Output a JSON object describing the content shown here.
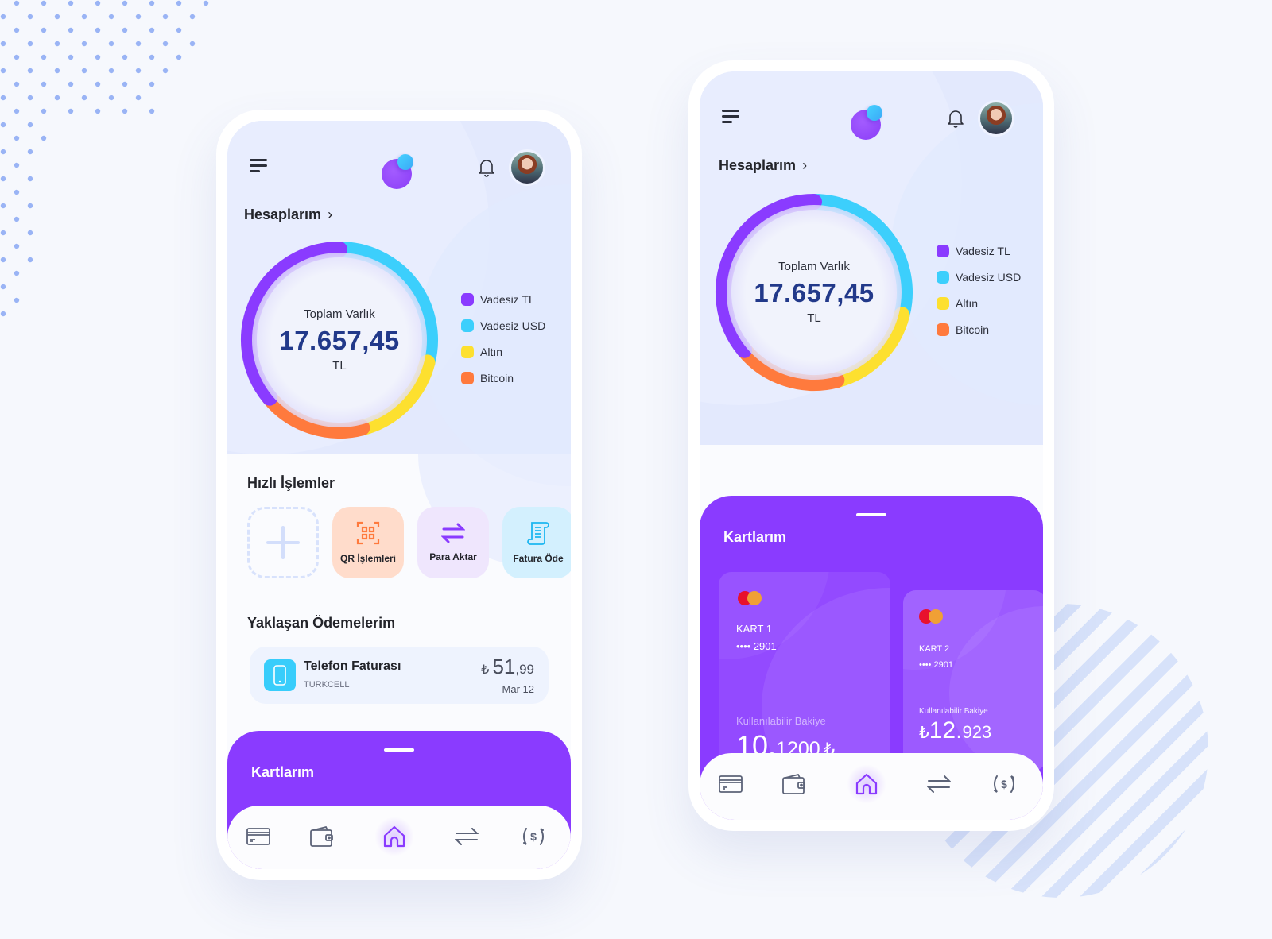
{
  "colors": {
    "accent": "#8a3bff",
    "vadesiz_tl": "#8a3bff",
    "vadesiz_usd": "#3ccffc",
    "altin": "#fde02f",
    "bitcoin": "#ff7a3d",
    "amount_blue": "#22398a"
  },
  "header": {
    "menu_icon": "hamburger-menu-icon",
    "logo": "app-logo",
    "notification_icon": "bell-icon",
    "avatar": "user-avatar"
  },
  "accounts": {
    "link_label": "Hesaplarım",
    "chevron": "›"
  },
  "chart_data": {
    "type": "pie",
    "title": "Toplam Varlık",
    "total_value": "17.657,45",
    "total_unit": "TL",
    "categories": [
      "Vadesiz TL",
      "Vadesiz USD",
      "Altın",
      "Bitcoin"
    ],
    "values": [
      36,
      29,
      17,
      18
    ],
    "legend_position": "right"
  },
  "quick_actions": {
    "title": "Hızlı İşlemler",
    "items": [
      {
        "label": "",
        "icon": "plus-icon"
      },
      {
        "label": "QR İşlemleri",
        "icon": "qr-scan-icon"
      },
      {
        "label": "Para Aktar",
        "icon": "transfer-icon"
      },
      {
        "label": "Fatura Öde",
        "icon": "bill-icon"
      }
    ]
  },
  "upcoming": {
    "title": "Yaklaşan Ödemelerim",
    "items": [
      {
        "name": "Telefon Faturası",
        "provider": "TURKCELL",
        "currency": "₺",
        "amount_int": "51",
        "amount_dec": ",99",
        "date": "Mar 12"
      }
    ]
  },
  "cards": {
    "title": "Kartlarım",
    "items": [
      {
        "name": "KART 1",
        "masked": "•••• 2901",
        "balance_label": "Kullanılabilir Bakiye",
        "balance_int": "10.",
        "balance_dec": "1200",
        "currency": "₺"
      },
      {
        "name": "KART 2",
        "masked": "•••• 2901",
        "balance_label": "Kullanılabilir Bakiye",
        "balance_int": "12.",
        "balance_dec": "923",
        "currency": "₺"
      }
    ]
  },
  "tabbar": {
    "items": [
      {
        "name": "cards",
        "icon": "credit-card-icon"
      },
      {
        "name": "wallet",
        "icon": "wallet-icon"
      },
      {
        "name": "home",
        "icon": "home-icon",
        "active": true
      },
      {
        "name": "transfer",
        "icon": "transfer-icon"
      },
      {
        "name": "exchange",
        "icon": "currency-exchange-icon"
      }
    ]
  }
}
